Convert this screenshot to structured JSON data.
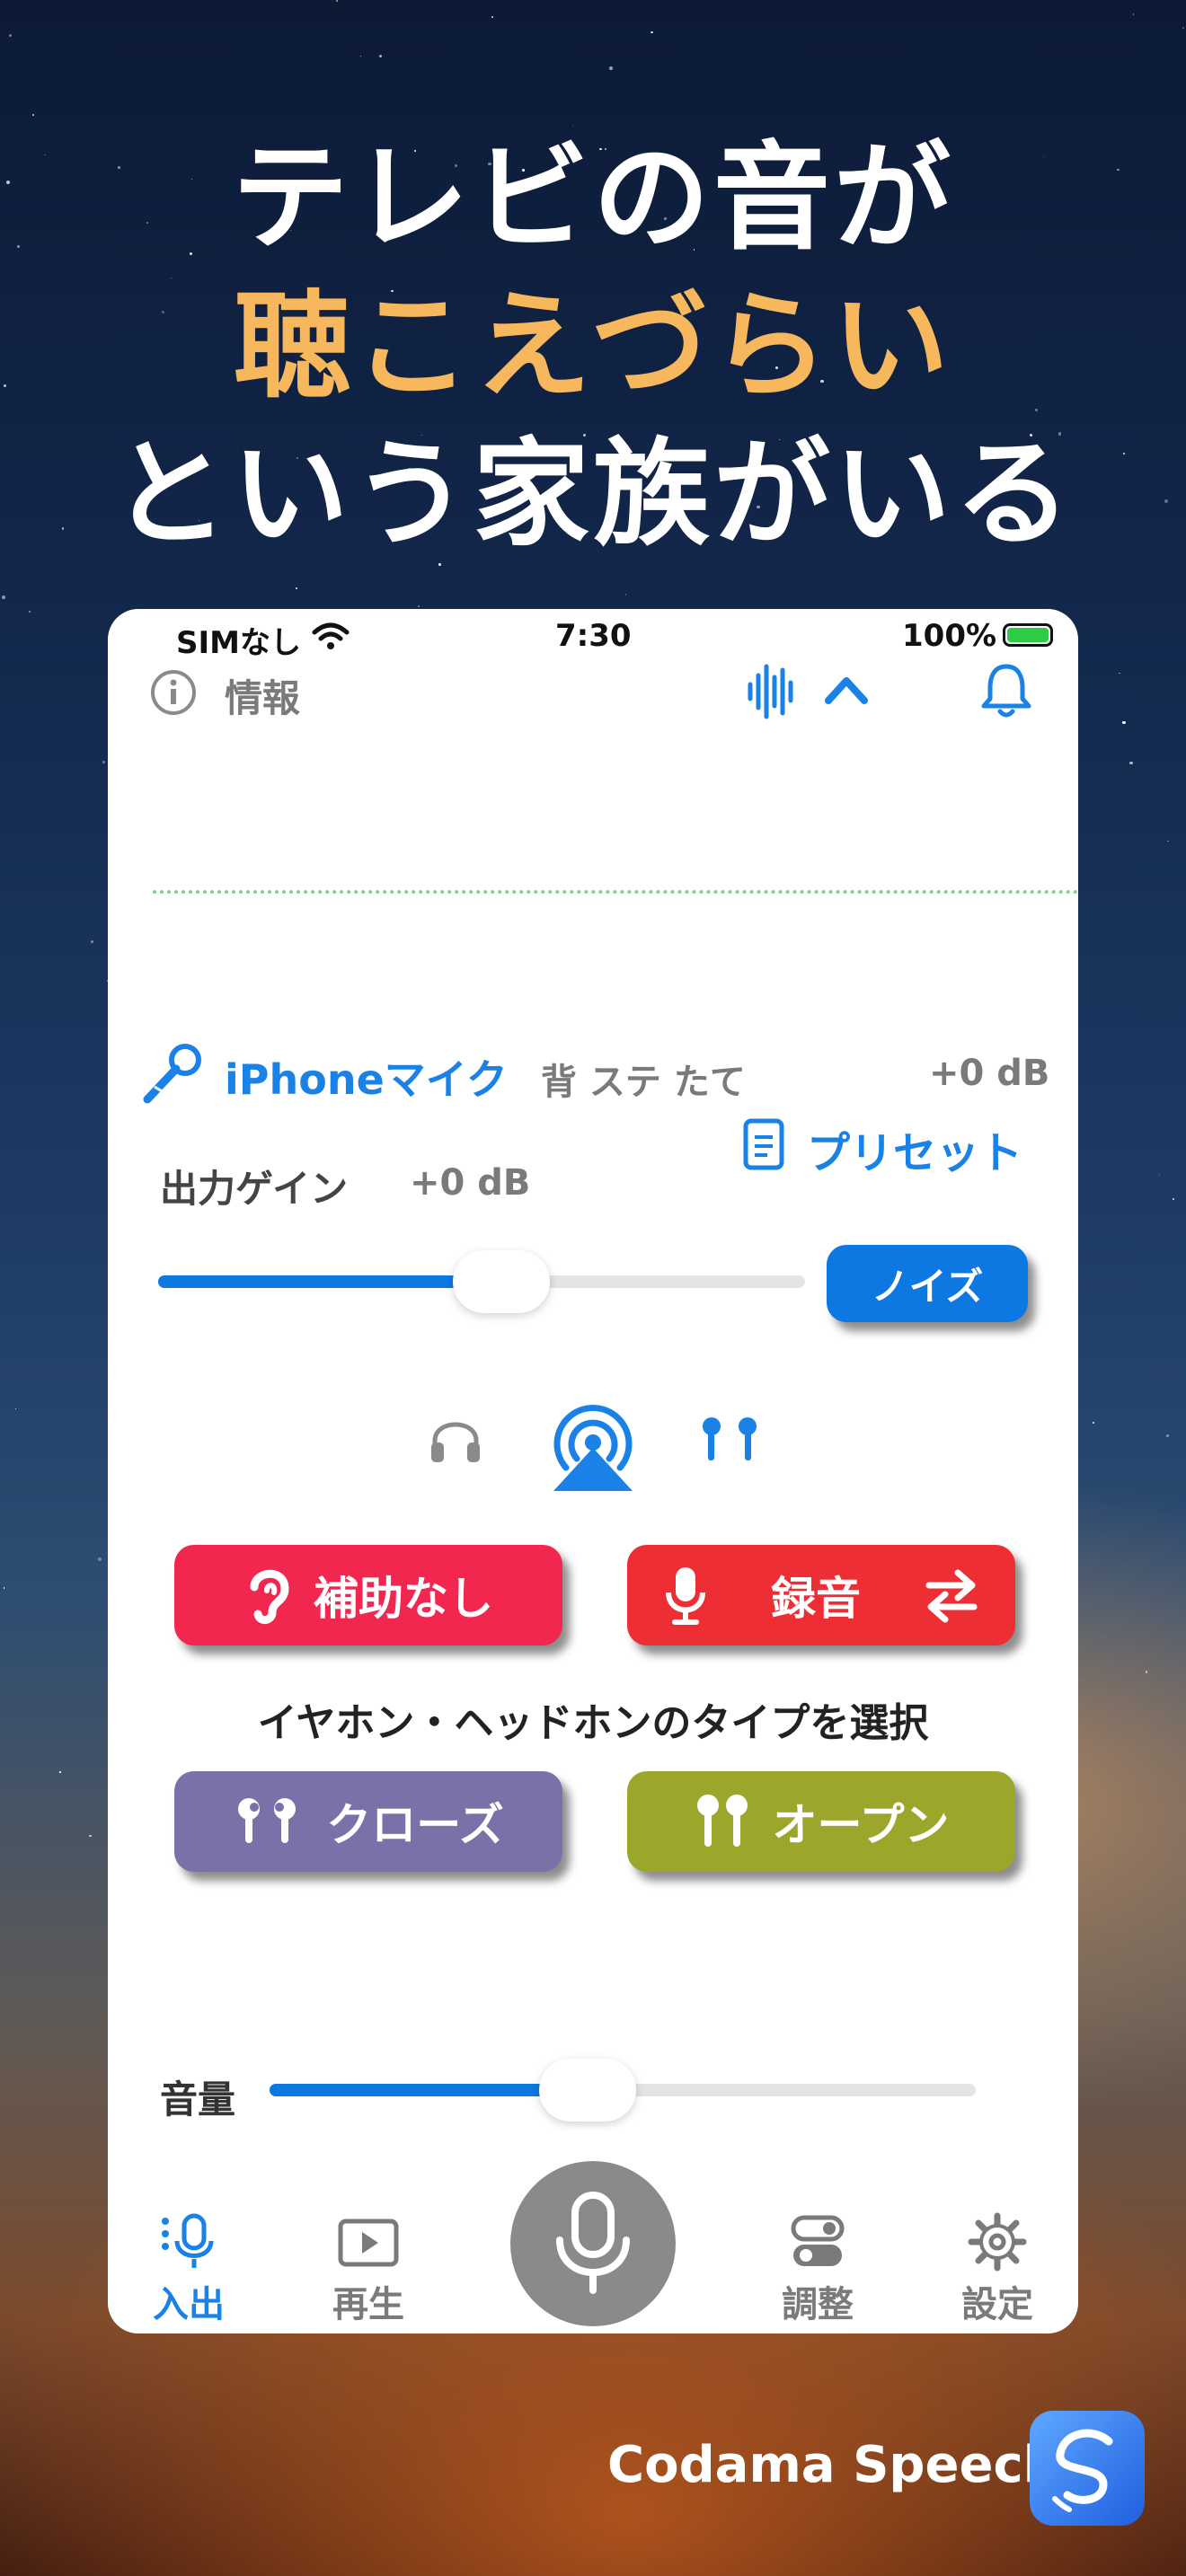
{
  "headline": {
    "line1": "テレビの音が",
    "line2": "聴こえづらい",
    "line3": "という家族がいる"
  },
  "status_bar": {
    "carrier": "SIMなし",
    "time": "7:30",
    "battery": "100%"
  },
  "top_bar": {
    "info_label": "情報",
    "info_icon": "info-circle-icon",
    "waveform_icon": "waveform-icon",
    "chevron_icon": "chevron-up-icon",
    "bell_icon": "bell-icon"
  },
  "input": {
    "mic_label": "iPhoneマイク",
    "mode_label": "背 ステ たて",
    "db": "+0 dB"
  },
  "preset": {
    "label": "プリセット"
  },
  "gain": {
    "label": "出力ゲイン",
    "value": "+0 dB",
    "level": 0.53
  },
  "noise_button": "ノイズ",
  "outputs": {
    "icons": [
      "headphones-icon",
      "airplay-icon",
      "earbuds-icon"
    ],
    "selected": "airplay-icon"
  },
  "mode_buttons": {
    "no_assist": "補助なし",
    "record": "録音"
  },
  "earphone_section": {
    "title": "イヤホン・ヘッドホンのタイプを選択",
    "closed": "クローズ",
    "open": "オープン"
  },
  "volume": {
    "label": "音量",
    "level": 0.45
  },
  "tabs": [
    {
      "label": "入出",
      "icon": "mic-io-icon",
      "active": true
    },
    {
      "label": "再生",
      "icon": "play-icon",
      "active": false
    },
    {
      "label": "",
      "icon": "mic-icon",
      "active": false
    },
    {
      "label": "調整",
      "icon": "toggles-icon",
      "active": false
    },
    {
      "label": "設定",
      "icon": "gear-icon",
      "active": false
    }
  ],
  "brand": {
    "name": "Codama Speech"
  },
  "colors": {
    "accent": "#1a82e6",
    "headline_highlight": "#f7b75c",
    "no_assist": "#f2274f",
    "record": "#ee2e35",
    "closed": "#7b71a8",
    "open": "#9ba62a",
    "noise": "#0d78e2"
  }
}
